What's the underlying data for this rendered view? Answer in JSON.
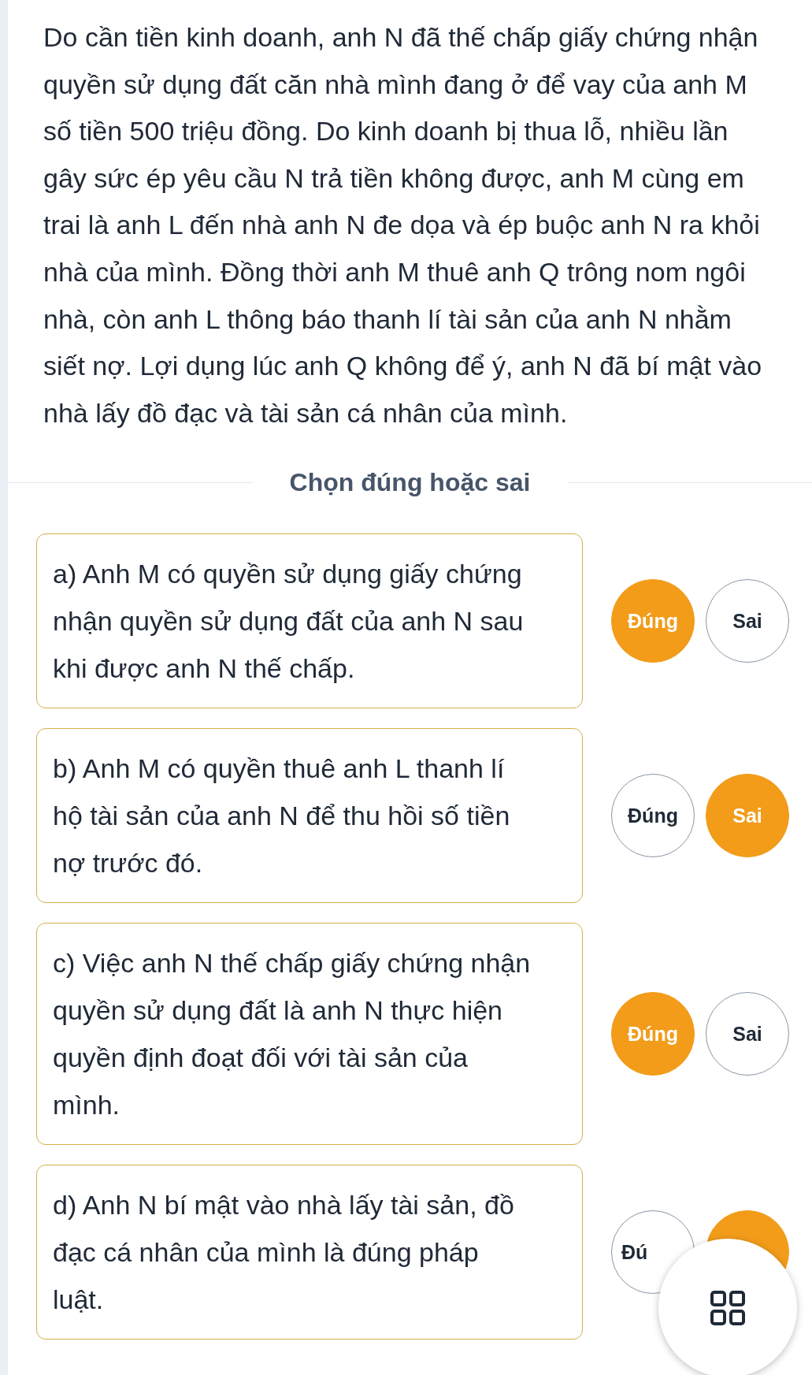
{
  "passage": "Do cần tiền kinh doanh, anh N đã thế chấp giấy chứng nhận quyền sử dụng đất căn nhà mình đang ở để vay của anh M số tiền 500 triệu đồng. Do kinh doanh bị thua lỗ, nhiều lần gây sức ép yêu cầu N trả tiền không được, anh M cùng em trai là anh L đến nhà anh N đe dọa và ép buộc anh N ra khỏi nhà của mình. Đồng thời anh M thuê anh Q trông nom ngôi nhà, còn anh L thông báo thanh lí tài sản của anh N nhằm siết nợ. Lợi dụng lúc anh Q không để ý, anh N đã bí mật vào nhà lấy đồ đạc và tài sản cá nhân của mình.",
  "section_title": "Chọn đúng hoặc sai",
  "items": [
    {
      "text": "a) Anh M có quyền sử dụng giấy chứng nhận quyền sử dụng đất của anh N sau khi được anh N thế chấp.",
      "options": [
        {
          "label": "Đúng",
          "selected": true
        },
        {
          "label": "Sai",
          "selected": false
        }
      ]
    },
    {
      "text": "b) Anh M có quyền thuê anh L thanh lí hộ tài sản của anh N để thu hồi số tiền nợ trước đó.",
      "options": [
        {
          "label": "Đúng",
          "selected": false
        },
        {
          "label": "Sai",
          "selected": true
        }
      ]
    },
    {
      "text": "c) Việc anh N thế chấp giấy chứng nhận quyền sử dụng đất là anh N thực hiện quyền định đoạt đối với tài sản của mình.",
      "options": [
        {
          "label": "Đúng",
          "selected": true
        },
        {
          "label": "Sai",
          "selected": false
        }
      ]
    },
    {
      "text": "d) Anh N bí mật vào nhà lấy tài sản, đồ đạc cá nhân của mình là đúng pháp luật.",
      "options": [
        {
          "label": "Đú",
          "selected": false
        },
        {
          "selected": true
        }
      ]
    }
  ],
  "floating_button": {
    "kind": "grid"
  }
}
